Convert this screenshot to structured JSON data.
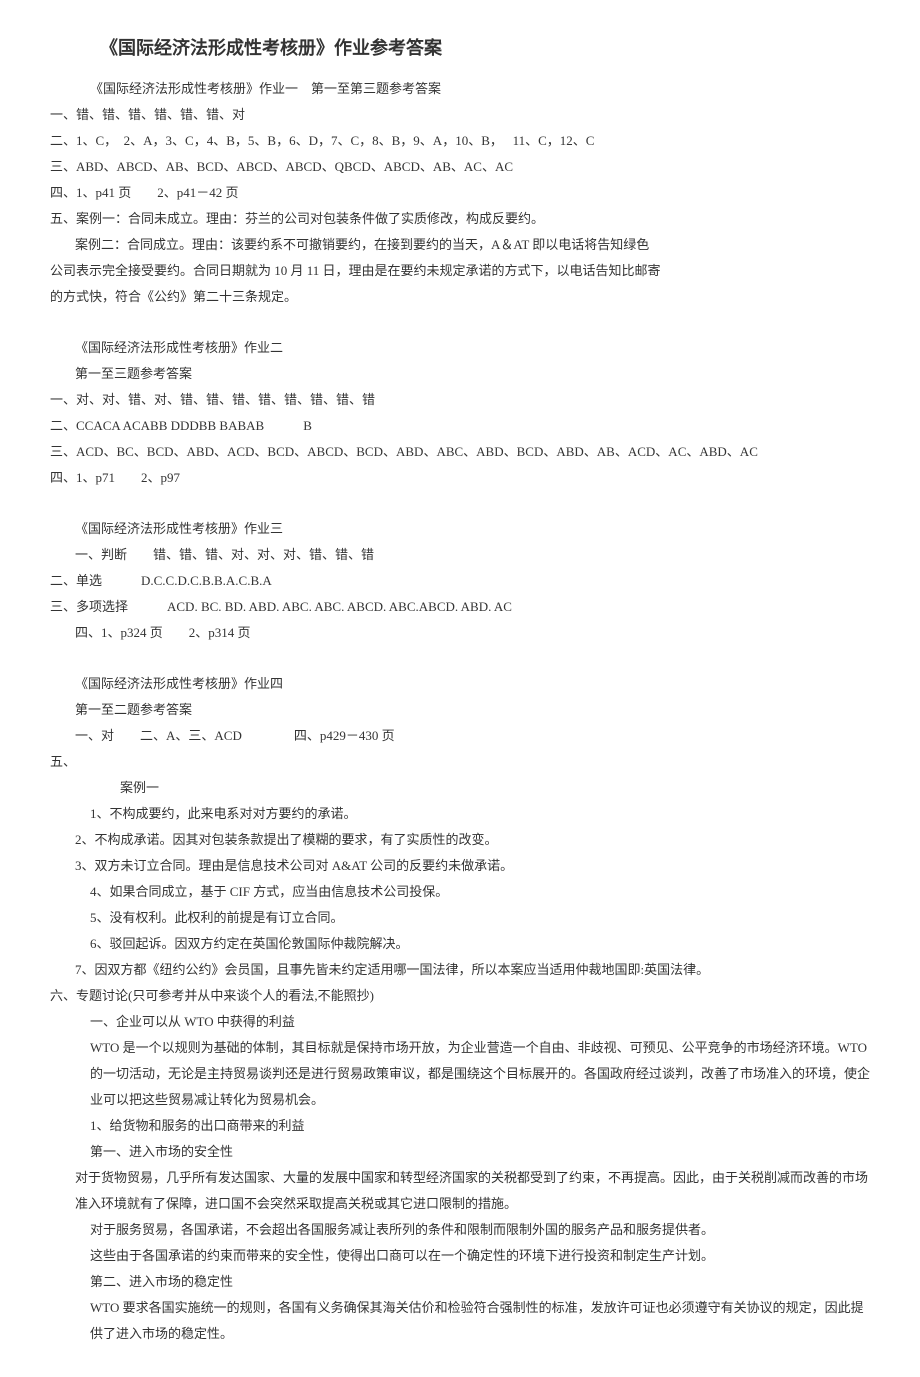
{
  "title": "《国际经济法形成性考核册》作业参考答案",
  "hw1_header": "《国际经济法形成性考核册》作业一　第一至第三题参考答案",
  "hw1_q1": "一、错、错、错、错、错、错、对",
  "hw1_q2": "二、1、C，　2、A，3、C，4、B，5、B，6、D，7、C，8、B，9、A，10、B，　 11、C，12、C",
  "hw1_q3": "三、ABD、ABCD、AB、BCD、ABCD、ABCD、QBCD、ABCD、AB、AC、AC",
  "hw1_q4": "四、1、p41 页　　2、p41－42 页",
  "hw1_q5": "五、案例一：合同未成立。理由：芬兰的公司对包装条件做了实质修改，构成反要约。",
  "hw1_case2_a": "案例二：合同成立。理由：该要约系不可撤销要约，在接到要约的当天，A＆AT 即以电话将告知绿色",
  "hw1_case2_b": "公司表示完全接受要约。合同日期就为 10 月 11 日，理由是在要约未规定承诺的方式下，以电话告知比邮寄",
  "hw1_case2_c": "的方式快，符合《公约》第二十三条规定。",
  "hw2_header": "《国际经济法形成性考核册》作业二",
  "hw2_sub": "第一至三题参考答案",
  "hw2_q1": "一、对、对、错、对、错、错、错、错、错、错、错、错",
  "hw2_q2": "二、CCACA ACABB DDDBB BABAB　　　B",
  "hw2_q3": "三、ACD、BC、BCD、ABD、ACD、BCD、ABCD、BCD、ABD、ABC、ABD、BCD、ABD、AB、ACD、AC、ABD、AC",
  "hw2_q4": "四、1、p71　　2、p97",
  "hw3_header": "《国际经济法形成性考核册》作业三",
  "hw3_q1": "一、判断　　错、错、错、对、对、对、错、错、错",
  "hw3_q2": "二、单选　　　D.C.C.D.C.B.B.A.C.B.A",
  "hw3_q3": "三、多项选择　　　ACD. BC. BD. ABD. ABC. ABC. ABCD. ABC.ABCD. ABD. AC",
  "hw3_q4": "四、1、p324 页　　2、p314 页",
  "hw4_header": "《国际经济法形成性考核册》作业四",
  "hw4_sub": "第一至二题参考答案",
  "hw4_q1": "一、对　　二、A、三、ACD　　　　四、p429－430 页",
  "hw4_q5": "五、",
  "case1_label": "案例一",
  "case1_1": "1、不构成要约，此来电系对对方要约的承诺。",
  "case1_2": "2、不构成承诺。因其对包装条款提出了模糊的要求，有了实质性的改变。",
  "case1_3": "3、双方未订立合同。理由是信息技术公司对 A&AT 公司的反要约未做承诺。",
  "case1_4": "4、如果合同成立，基于 CIF 方式，应当由信息技术公司投保。",
  "case1_5": "5、没有权利。此权利的前提是有订立合同。",
  "case1_6": "6、驳回起诉。因双方约定在英国伦敦国际仲裁院解决。",
  "case1_7": "7、因双方都《纽约公约》会员国，且事先皆未约定适用哪一国法律，所以本案应当适用仲裁地国即:英国法律。",
  "topic6": "六、专题讨论(只可参考并从中来谈个人的看法,不能照抄)",
  "topic6_h1": "一、企业可以从 WTO 中获得的利益",
  "topic6_p1": "WTO 是一个以规则为基础的体制，其目标就是保持市场开放，为企业营造一个自由、非歧视、可预见、公平竞争的市场经济环境。WTO 的一切活动，无论是主持贸易谈判还是进行贸易政策审议，都是围绕这个目标展开的。各国政府经过谈判，改善了市场准入的环境，使企业可以把这些贸易减让转化为贸易机会。",
  "topic6_sub1": "1、给货物和服务的出口商带来的利益",
  "topic6_s1a": "第一、进入市场的安全性",
  "topic6_p2a": "对于货物贸易，几乎所有发达国家、大量的发展中国家和转型经济国家的关税都受到了约束，不再提高。因此，由于关税削减而改善的市场准入环境就有了保障，进口国不会突然采取提高关税或其它进口限制的措施。",
  "topic6_p2b": "对于服务贸易，各国承诺，不会超出各国服务减让表所列的条件和限制而限制外国的服务产品和服务提供者。",
  "topic6_p2c": "这些由于各国承诺的约束而带来的安全性，使得出口商可以在一个确定性的环境下进行投资和制定生产计划。",
  "topic6_s1b": "第二、进入市场的稳定性",
  "topic6_p3": "WTO 要求各国实施统一的规则，各国有义务确保其海关估价和检验符合强制性的标准，发放许可证也必须遵守有关协议的规定，因此提供了进入市场的稳定性。"
}
